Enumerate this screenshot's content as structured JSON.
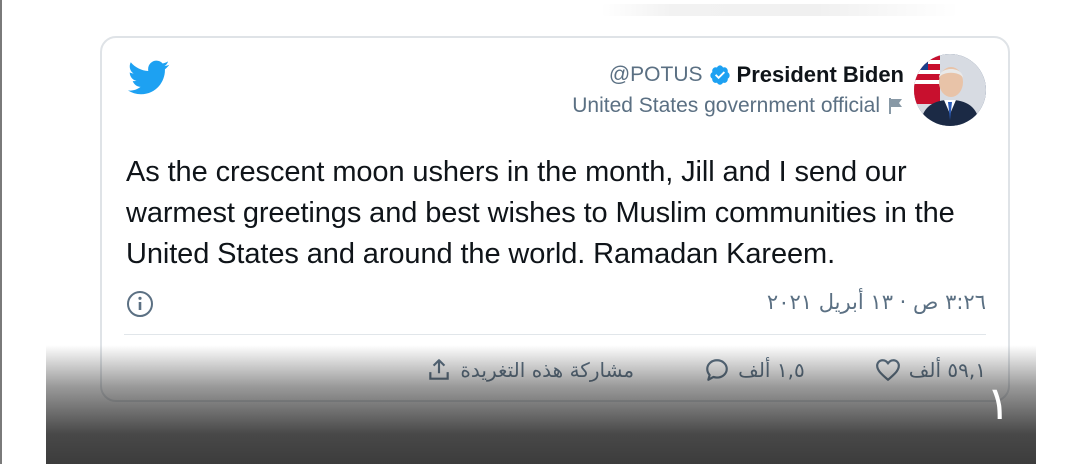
{
  "tweet": {
    "handle": "@POTUS",
    "display_name": "President Biden",
    "account_label": "United States government official",
    "text": "As the crescent moon ushers in the month, Jill and I send our warmest greetings and best wishes to Muslim communities in the United States and around the world. Ramadan Kareem.",
    "timestamp": "٣:٢٦ ص · ١٣ أبريل ٢٠٢١",
    "actions": {
      "likes": "٥٩,١ ألف",
      "replies": "١,٥ ألف",
      "share_label": "مشاركة هذه التغريدة"
    }
  },
  "overlay": {
    "page_number": "١"
  },
  "colors": {
    "twitter_blue": "#1da1f2",
    "text_primary": "#0f1419",
    "text_secondary": "#5b7083",
    "card_border": "#dfe3e7"
  },
  "icons": [
    "twitter-logo-icon",
    "verified-badge-icon",
    "flag-icon",
    "info-icon",
    "heart-icon",
    "reply-icon",
    "share-icon"
  ]
}
